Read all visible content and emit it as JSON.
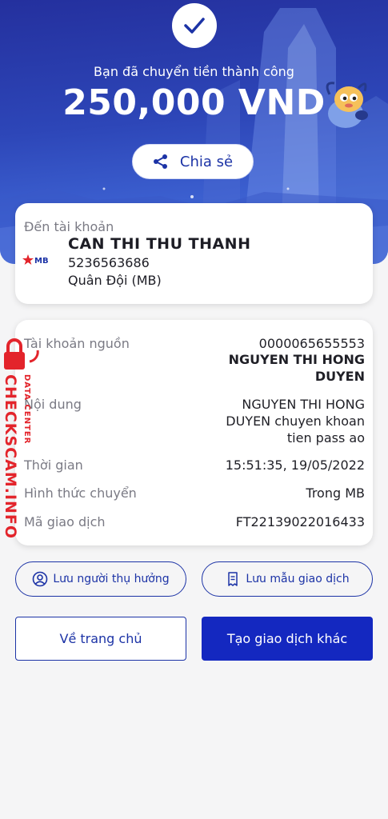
{
  "header": {
    "success_text": "Bạn đã chuyển tiền thành công",
    "amount": "250,000 VND",
    "share_label": "Chia sẻ"
  },
  "recipient": {
    "label": "Đến tài khoản",
    "name": "CAN THI THU THANH",
    "account_number": "5236563686",
    "bank": "Quân Đội (MB)",
    "bank_logo_text": "MB"
  },
  "details": {
    "source_label": "Tài khoản nguồn",
    "source_account": "0000065655553",
    "source_name_line1": "NGUYEN THI HONG",
    "source_name_line2": "DUYEN",
    "content_label": "Nội dung",
    "content_line1": "NGUYEN THI HONG",
    "content_line2": "DUYEN chuyen khoan",
    "content_line3": "tien pass ao",
    "time_label": "Thời gian",
    "time_value": "15:51:35, 19/05/2022",
    "method_label": "Hình thức chuyển",
    "method_value": "Trong MB",
    "txn_label": "Mã giao dịch",
    "txn_value": "FT22139022016433"
  },
  "actions": {
    "save_beneficiary": "Lưu người thụ hưởng",
    "save_template": "Lưu mẫu giao dịch",
    "home": "Về trang chủ",
    "new_transaction": "Tạo giao dịch khác"
  },
  "watermark": {
    "text": "CHECKSCAM.INFO",
    "sub": "DATA CENTER"
  },
  "colors": {
    "primary": "#1c33a6",
    "button_fill": "#1428c0",
    "hero_top": "#24309e",
    "watermark": "#e3242b"
  }
}
